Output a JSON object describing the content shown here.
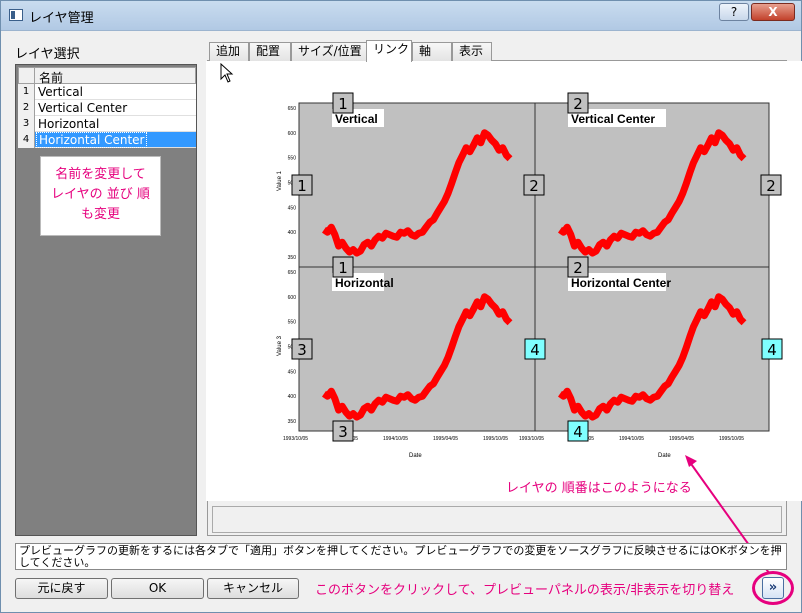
{
  "window": {
    "title": "レイヤ管理",
    "help_label": "?",
    "close_label": "X"
  },
  "layer_select": {
    "label": "レイヤ選択",
    "column_header": "名前",
    "rows": [
      {
        "num": "1",
        "name": "Vertical"
      },
      {
        "num": "2",
        "name": "Vertical Center"
      },
      {
        "num": "3",
        "name": "Horizontal"
      },
      {
        "num": "4",
        "name": "Horizontal Center"
      }
    ],
    "selected_row": 4,
    "note": "名前を変更して\nレイヤの 並び 順\nも変更"
  },
  "tabs": [
    {
      "label": "追加"
    },
    {
      "label": "配置"
    },
    {
      "label": "サイズ/位置"
    },
    {
      "label": "リンク",
      "active": true
    },
    {
      "label": "軸"
    },
    {
      "label": "表示"
    }
  ],
  "preview": {
    "layers": [
      {
        "title": "Vertical",
        "num": "1",
        "left_tag": "1",
        "right_tag": "2",
        "bottom_tag": "1"
      },
      {
        "title": "Vertical Center",
        "num": "2",
        "right_tag": "2",
        "bottom_tag": "2"
      },
      {
        "title": "Horizontal",
        "left_tag": "3",
        "right_tag": "4",
        "bottom_tag": "3"
      },
      {
        "title": "Horizontal Center",
        "right_tag": "4",
        "bottom_tag": "4"
      }
    ],
    "y_ticks": [
      "650",
      "600",
      "550",
      "500",
      "450",
      "400",
      "350"
    ],
    "y_label_top": "Value 1",
    "y_label_bottom": "Value 3",
    "x_ticks_left": [
      "1993/10/05",
      "1994/04/05",
      "1994/10/05",
      "1995/04/05",
      "1995/10/05"
    ],
    "x_ticks_right": [
      "1993/10/05",
      "1994/04/05",
      "1994/10/05",
      "1995/04/05",
      "1995/10/05"
    ],
    "x_label": "Date",
    "colors": {
      "plot_bg": "#c0c0c0",
      "series": "#ff0000",
      "tag_gray": "#c0c0c0",
      "tag_cyan": "#7fffff"
    }
  },
  "hint_order": "レイヤの 順番はこのようになる",
  "status_text": "プレビューグラフの更新をするには各タブで「適用」ボタンを押してください。プレビューグラフでの変更をソースグラフに反映させるにはOKボタンを押してください。",
  "buttons": {
    "undo": "元に戻す",
    "ok": "OK",
    "cancel": "キャンセル",
    "toggle": "»"
  },
  "hint_bottom": "このボタンをクリックして、プレビューパネルの表示/非表示を切り替え"
}
